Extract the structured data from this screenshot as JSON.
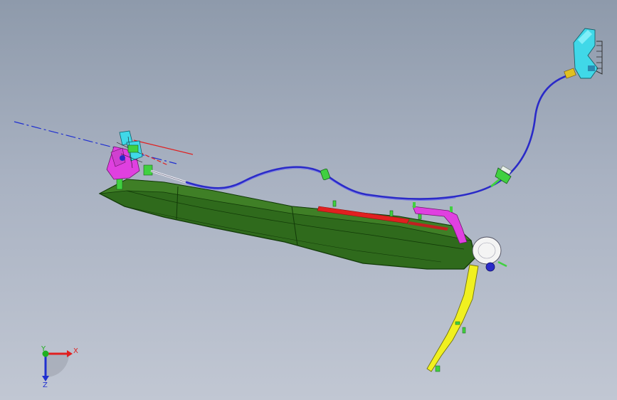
{
  "viewport": {
    "background_top": "#8e9aab",
    "background_bottom": "#c1c7d3"
  },
  "triad": {
    "x_label": "X",
    "y_label": "Y",
    "z_label": "Z",
    "x_color": "#e02020",
    "y_color": "#20b020",
    "z_color": "#2030d0"
  },
  "colors": {
    "main_body": "#2f6a1c",
    "main_body_edge": "#123a08",
    "cable": "#2a2ac8",
    "bracket_magenta": "#e040e0",
    "clip_cyan": "#40d8e8",
    "arm_yellow": "#f0f020",
    "strip_red": "#e02020",
    "clip_green": "#40d040",
    "centerline": "#2030d0",
    "ref_line_red": "#e02020"
  },
  "icons": {
    "triad": "coordinate-triad-icon"
  }
}
